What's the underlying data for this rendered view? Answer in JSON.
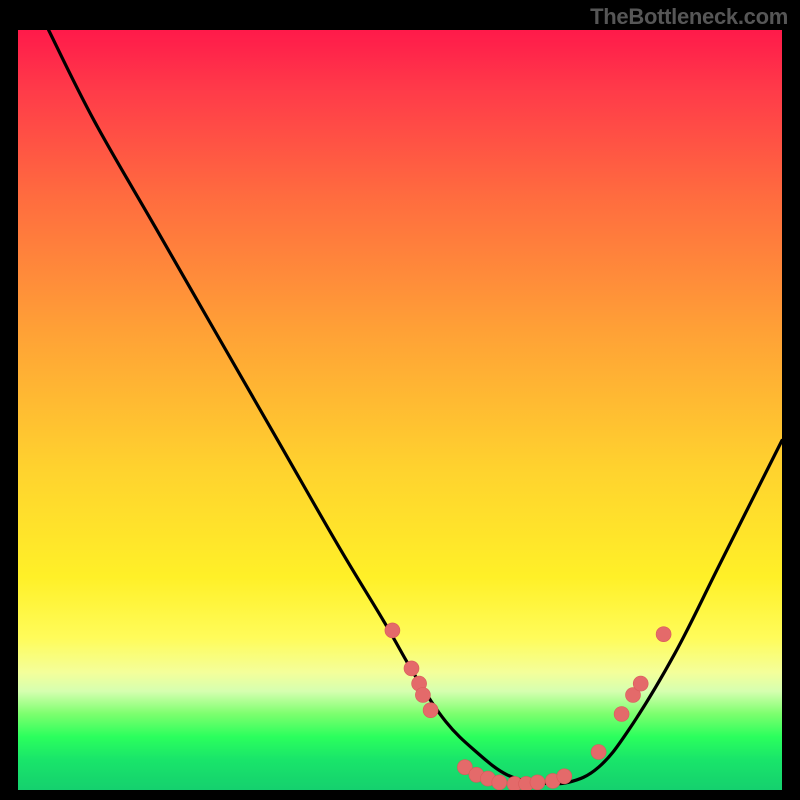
{
  "attribution": "TheBottleneck.com",
  "chart_data": {
    "type": "line",
    "title": "",
    "xlabel": "",
    "ylabel": "",
    "xlim": [
      0,
      100
    ],
    "ylim": [
      0,
      100
    ],
    "series": [
      {
        "name": "bottleneck-curve",
        "x": [
          4,
          10,
          18,
          26,
          34,
          42,
          48,
          52,
          56,
          60,
          64,
          68,
          72,
          76,
          80,
          86,
          92,
          100
        ],
        "y": [
          100,
          88,
          74,
          60,
          46,
          32,
          22,
          15,
          9,
          5,
          2,
          1,
          1,
          3,
          8,
          18,
          30,
          46
        ]
      }
    ],
    "markers": [
      {
        "x": 49.0,
        "y": 21.0
      },
      {
        "x": 51.5,
        "y": 16.0
      },
      {
        "x": 52.5,
        "y": 14.0
      },
      {
        "x": 53.0,
        "y": 12.5
      },
      {
        "x": 54.0,
        "y": 10.5
      },
      {
        "x": 58.5,
        "y": 3.0
      },
      {
        "x": 60.0,
        "y": 2.0
      },
      {
        "x": 61.5,
        "y": 1.5
      },
      {
        "x": 63.0,
        "y": 1.0
      },
      {
        "x": 65.0,
        "y": 0.8
      },
      {
        "x": 66.5,
        "y": 0.8
      },
      {
        "x": 68.0,
        "y": 1.0
      },
      {
        "x": 70.0,
        "y": 1.2
      },
      {
        "x": 71.5,
        "y": 1.8
      },
      {
        "x": 76.0,
        "y": 5.0
      },
      {
        "x": 79.0,
        "y": 10.0
      },
      {
        "x": 80.5,
        "y": 12.5
      },
      {
        "x": 81.5,
        "y": 14.0
      },
      {
        "x": 84.5,
        "y": 20.5
      }
    ],
    "gradient_stops": [
      {
        "pos": 0,
        "color": "#ff1a4a"
      },
      {
        "pos": 0.58,
        "color": "#ffd32e"
      },
      {
        "pos": 0.93,
        "color": "#2bff5d"
      },
      {
        "pos": 1.0,
        "color": "#15d06e"
      }
    ]
  }
}
